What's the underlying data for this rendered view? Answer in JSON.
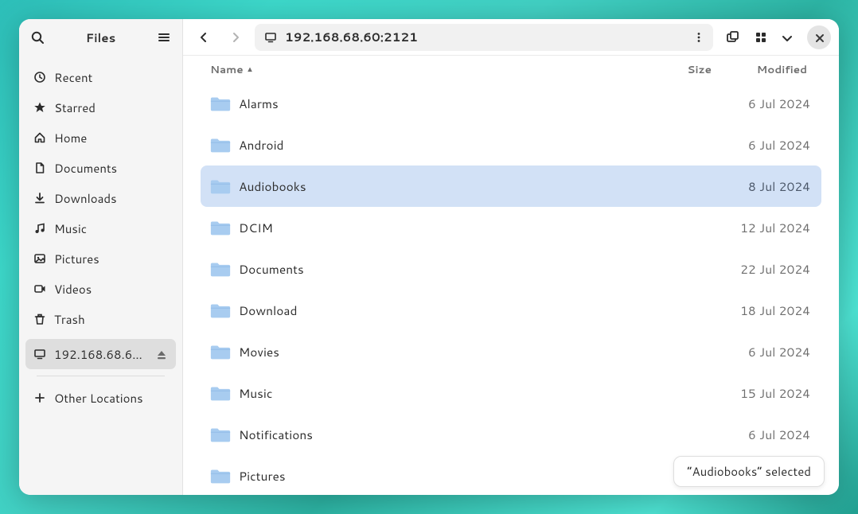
{
  "app": {
    "title": "Files"
  },
  "sidebar": {
    "items": [
      {
        "icon": "clock",
        "label": "Recent"
      },
      {
        "icon": "star",
        "label": "Starred"
      },
      {
        "icon": "home",
        "label": "Home"
      },
      {
        "icon": "doc",
        "label": "Documents"
      },
      {
        "icon": "download",
        "label": "Downloads"
      },
      {
        "icon": "music",
        "label": "Music"
      },
      {
        "icon": "pictures",
        "label": "Pictures"
      },
      {
        "icon": "videos",
        "label": "Videos"
      },
      {
        "icon": "trash",
        "label": "Trash"
      }
    ],
    "network": {
      "label": "192.168.68.6…",
      "active": true
    },
    "other": {
      "label": "Other Locations"
    }
  },
  "toolbar": {
    "address": "192.168.68.60:2121"
  },
  "columns": {
    "name": "Name",
    "size": "Size",
    "modified": "Modified",
    "sort_indicator": "▴"
  },
  "files": [
    {
      "name": "Alarms",
      "size": "",
      "modified": "6 Jul 2024",
      "selected": false
    },
    {
      "name": "Android",
      "size": "",
      "modified": "6 Jul 2024",
      "selected": false
    },
    {
      "name": "Audiobooks",
      "size": "",
      "modified": "8 Jul 2024",
      "selected": true
    },
    {
      "name": "DCIM",
      "size": "",
      "modified": "12 Jul 2024",
      "selected": false
    },
    {
      "name": "Documents",
      "size": "",
      "modified": "22 Jul 2024",
      "selected": false
    },
    {
      "name": "Download",
      "size": "",
      "modified": "18 Jul 2024",
      "selected": false
    },
    {
      "name": "Movies",
      "size": "",
      "modified": "6 Jul 2024",
      "selected": false
    },
    {
      "name": "Music",
      "size": "",
      "modified": "15 Jul 2024",
      "selected": false
    },
    {
      "name": "Notifications",
      "size": "",
      "modified": "6 Jul 2024",
      "selected": false
    },
    {
      "name": "Pictures",
      "size": "",
      "modified": "",
      "selected": false
    }
  ],
  "status": {
    "text": "“Audiobooks” selected"
  },
  "icons": {
    "clock": "clock",
    "star": "star",
    "home": "home",
    "doc": "doc",
    "download": "download",
    "music": "music",
    "pictures": "pictures",
    "videos": "videos",
    "trash": "trash",
    "screen": "screen",
    "plus": "plus"
  }
}
